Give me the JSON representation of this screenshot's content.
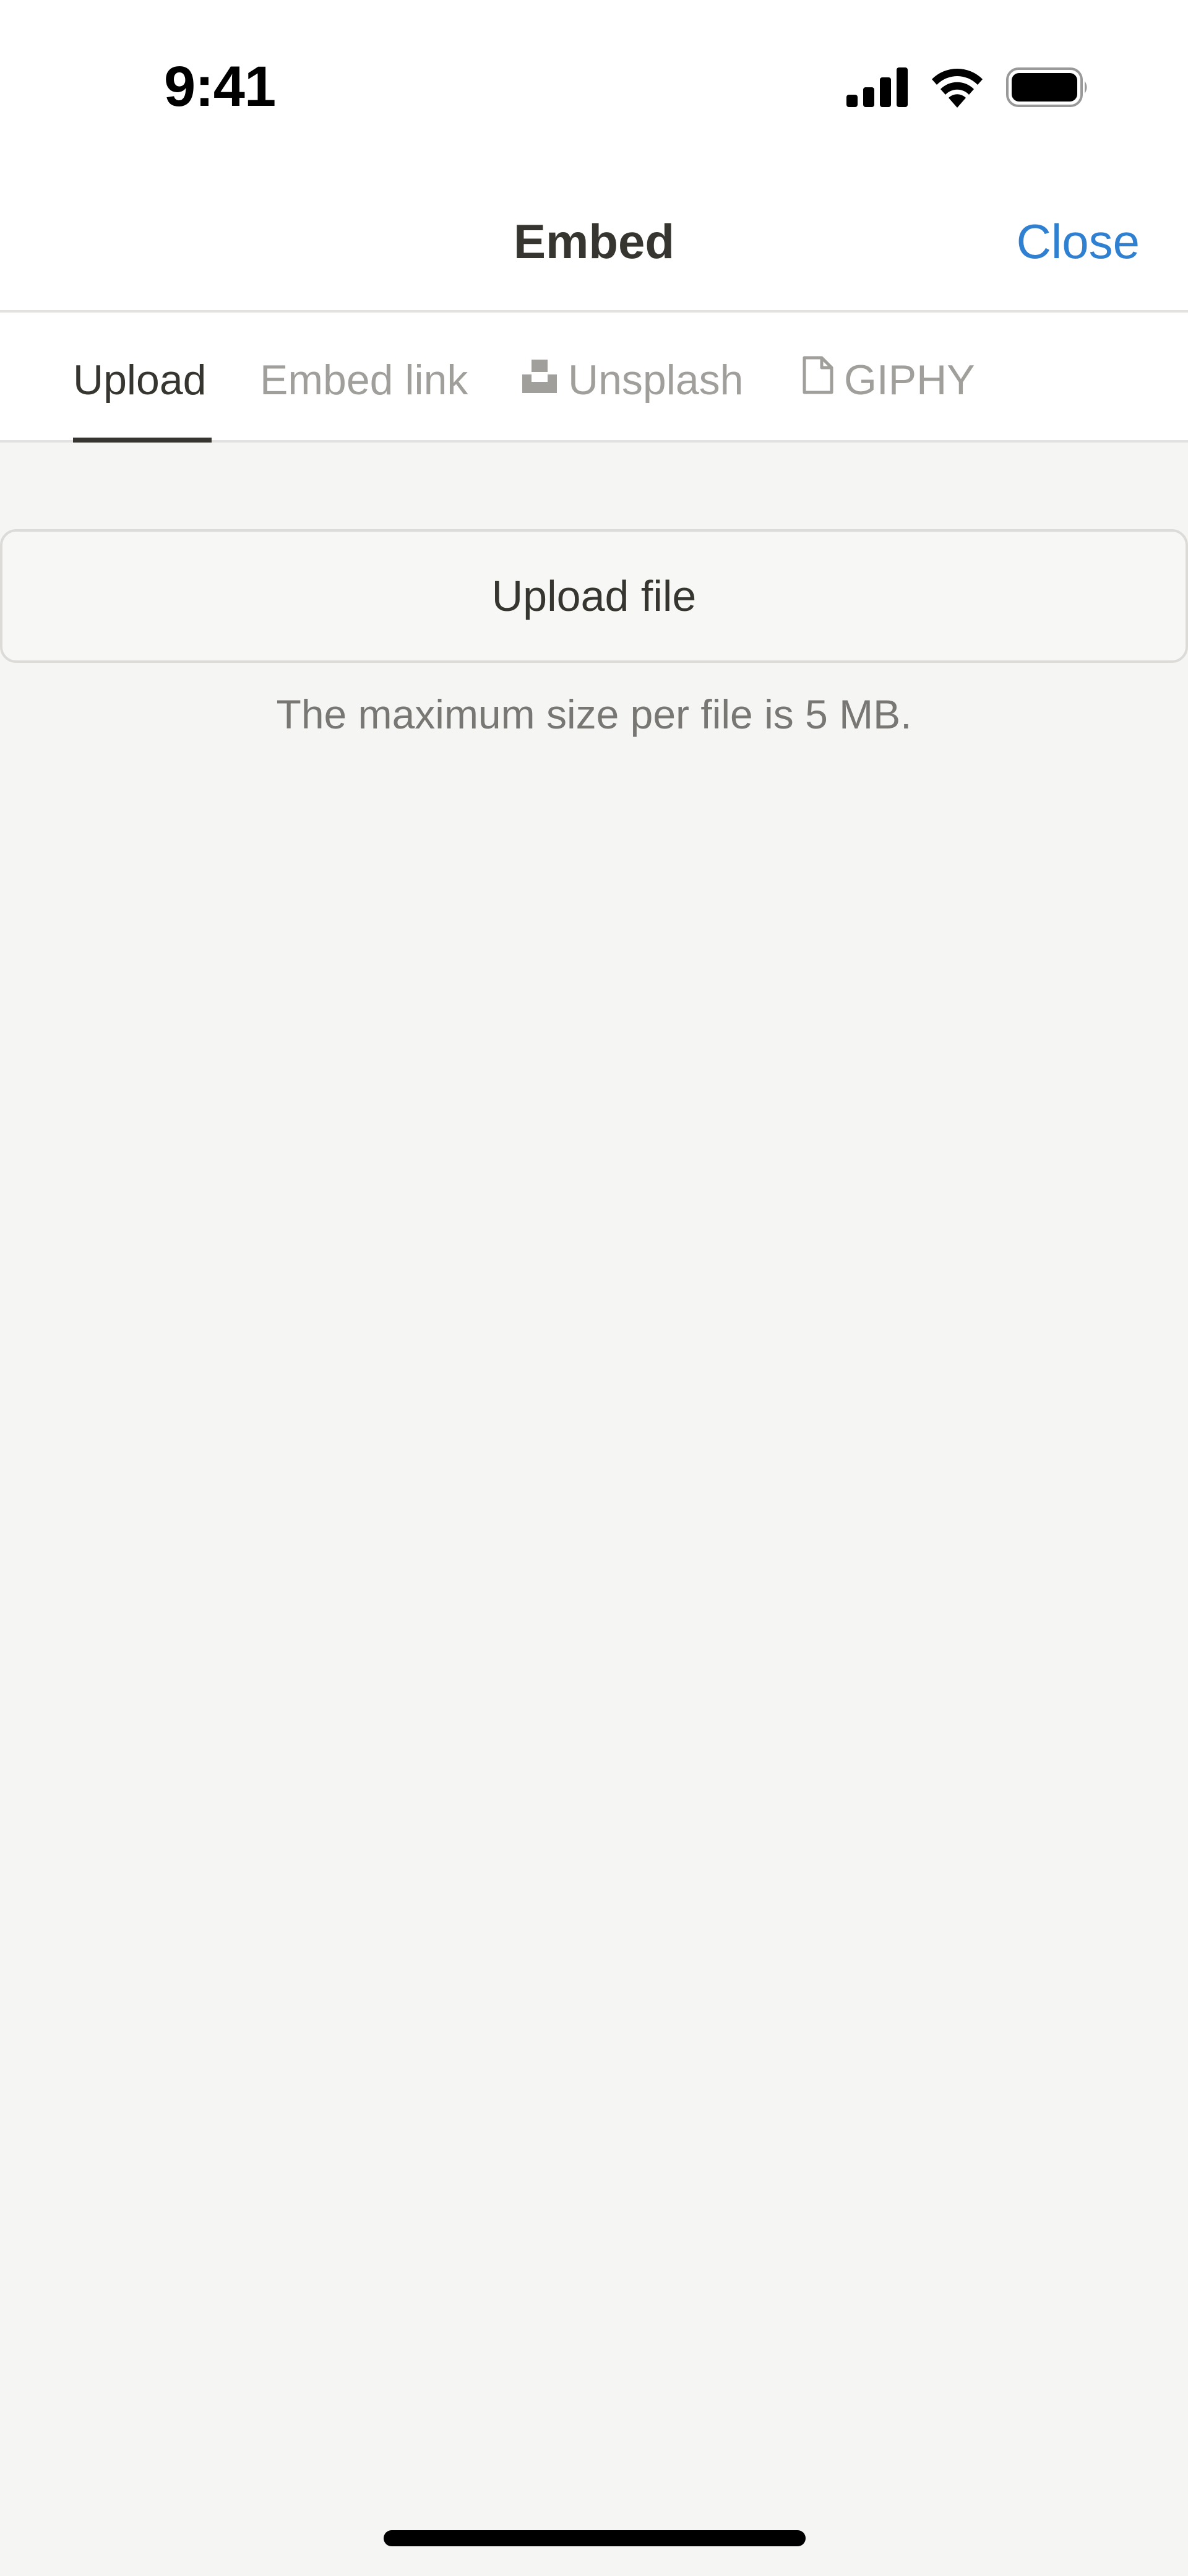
{
  "status_bar": {
    "time": "9:41",
    "icons": [
      "cellular-signal-icon",
      "wifi-icon",
      "battery-icon"
    ]
  },
  "nav": {
    "title": "Embed",
    "close_label": "Close"
  },
  "tabs": [
    {
      "label": "Upload",
      "active": true,
      "icon": null
    },
    {
      "label": "Embed link",
      "active": false,
      "icon": null
    },
    {
      "label": "Unsplash",
      "active": false,
      "icon": "unsplash-icon"
    },
    {
      "label": "GIPHY",
      "active": false,
      "icon": "document-icon"
    }
  ],
  "upload": {
    "button_label": "Upload file",
    "note": "The maximum size per file is 5 MB."
  },
  "colors": {
    "accent": "#2f80d1",
    "text_primary": "#37352f",
    "text_muted": "#a19f9b",
    "background": "#f5f5f4"
  }
}
